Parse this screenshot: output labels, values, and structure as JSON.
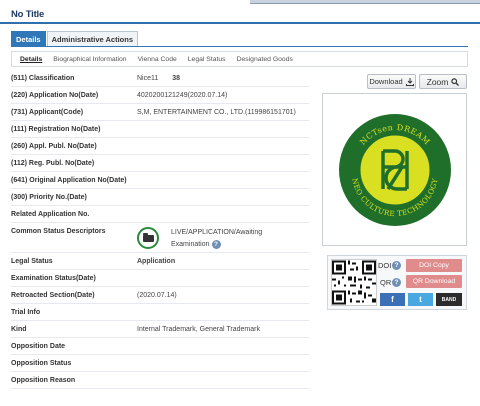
{
  "page": {
    "title": "No Title"
  },
  "main_tabs": [
    {
      "label": "Details",
      "active": true
    },
    {
      "label": "Administrative Actions",
      "active": false
    }
  ],
  "sub_tabs": [
    {
      "label": "Details",
      "active": true
    },
    {
      "label": "Biographical Information"
    },
    {
      "label": "Vienna Code"
    },
    {
      "label": "Legal Status"
    },
    {
      "label": "Designated Goods"
    }
  ],
  "fields": {
    "classification": {
      "label": "(511) Classification",
      "code": "Nice11",
      "value": "38"
    },
    "application_no": {
      "label": "(220) Application No(Date)",
      "value": "4020200121249(2020.07.14)"
    },
    "applicant": {
      "label": "(731) Applicant(Code)",
      "value": "S,M, ENTERTAINMENT CO., LTD.(119986151701)"
    },
    "registration_no": {
      "label": "(111) Registration No(Date)",
      "value": ""
    },
    "appl_publ_no": {
      "label": "(260) Appl. Publ. No(Date)",
      "value": ""
    },
    "reg_publ_no": {
      "label": "(112) Reg. Publ. No(Date)",
      "value": ""
    },
    "original_application_no": {
      "label": "(641) Original Application No(Date)",
      "value": ""
    },
    "priority_no": {
      "label": "(300) Priority No.(Date)",
      "value": ""
    },
    "related_application_no": {
      "label": "Related Application No.",
      "value": ""
    },
    "common_status": {
      "label": "Common Status Descriptors",
      "line1": "LIVE/APPLICATION/Awaiting",
      "line2": "Examination",
      "help": "?"
    },
    "legal_status": {
      "label": "Legal Status",
      "value": "Application"
    },
    "examination_status": {
      "label": "Examination Status(Date)",
      "value": ""
    },
    "retroacted_section": {
      "label": "Retroacted Section(Date)",
      "value": "(2020.07.14)"
    },
    "trial_info": {
      "label": "Trial Info",
      "value": ""
    },
    "kind": {
      "label": "Kind",
      "value": "Internal Trademark, General Trademark"
    },
    "opposition_date": {
      "label": "Opposition Date",
      "value": ""
    },
    "opposition_status": {
      "label": "Opposition Status",
      "value": ""
    },
    "opposition_reason": {
      "label": "Opposition Reason",
      "value": ""
    }
  },
  "toolbar": {
    "download_label": "Download",
    "zoom_label": "Zoom"
  },
  "mark_image": {
    "text_top": "NCTsen DREAM",
    "text_bottom": "NEO CULTURE TECHNOLOGY",
    "colors": {
      "ring": "#1f6f2a",
      "accent": "#d9e021"
    }
  },
  "share": {
    "doi_label": "DOI",
    "qr_label": "QR",
    "help": "?",
    "doi_copy_label": "DOI Copy",
    "qr_download_label": "QR Download",
    "facebook_label": "f",
    "twitter_label": "t",
    "band_label": "BAND"
  }
}
